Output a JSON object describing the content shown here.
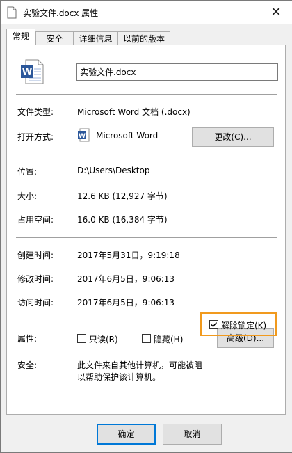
{
  "window": {
    "title": "实验文件.docx 属性"
  },
  "tabs": [
    {
      "label": "常规",
      "active": true
    },
    {
      "label": "安全"
    },
    {
      "label": "详细信息"
    },
    {
      "label": "以前的版本"
    }
  ],
  "file": {
    "name": "实验文件.docx"
  },
  "general": {
    "type_label": "文件类型:",
    "type_value": "Microsoft Word 文档 (.docx)",
    "opens_label": "打开方式:",
    "opens_value": "Microsoft Word",
    "change_button": "更改(C)...",
    "location_label": "位置:",
    "location_value": "D:\\Users\\Desktop",
    "size_label": "大小:",
    "size_value": "12.6 KB (12,927 字节)",
    "disk_label": "占用空间:",
    "disk_value": "16.0 KB (16,384 字节)",
    "created_label": "创建时间:",
    "created_value": "2017年5月31日，9:19:18",
    "modified_label": "修改时间:",
    "modified_value": "2017年6月5日，9:06:13",
    "accessed_label": "访问时间:",
    "accessed_value": "2017年6月5日，9:06:13",
    "attributes_label": "属性:",
    "readonly_label": "只读(R)",
    "hidden_label": "隐藏(H)",
    "advanced_button": "高级(D)...",
    "security_label": "安全:",
    "security_text_1": "此文件来自其他计算机，可能被阻",
    "security_text_2": "以帮助保护该计算机。",
    "unblock_label": "解除锁定(K)",
    "unblock_checked": true
  },
  "buttons": {
    "ok": "确定",
    "cancel": "取消"
  },
  "colors": {
    "highlight": "#f19a1e",
    "word_blue": "#2b579a"
  }
}
